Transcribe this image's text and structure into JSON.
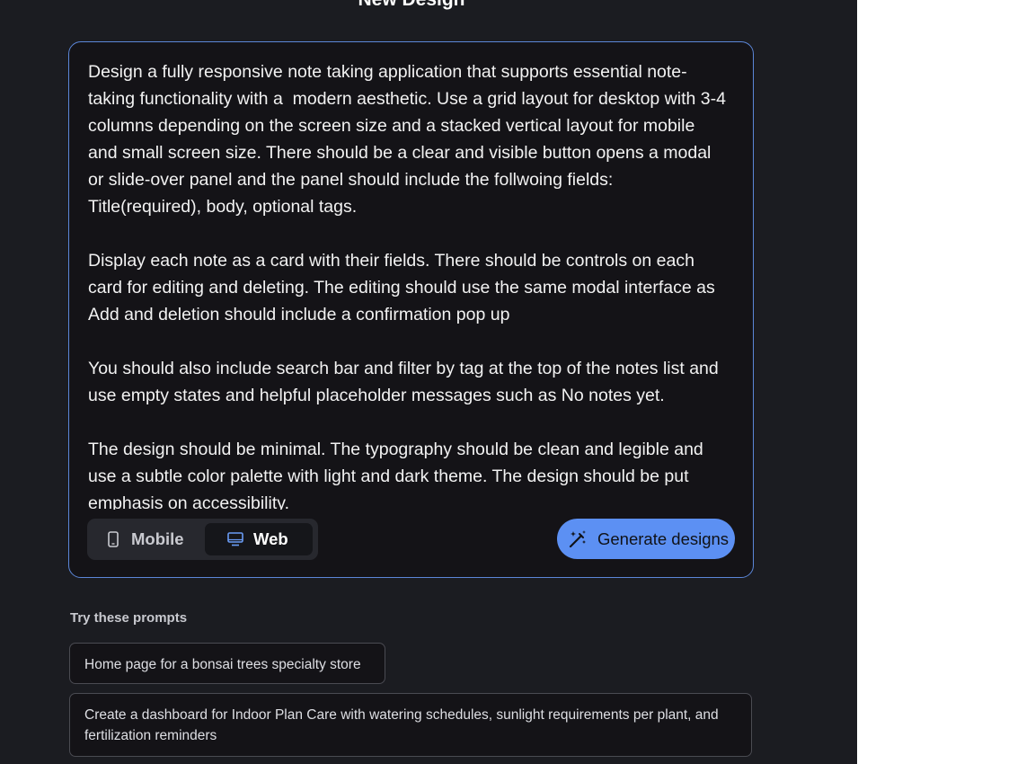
{
  "header": {
    "title": "New Design"
  },
  "prompt": {
    "text": "Design a fully responsive note taking application that supports essential note-taking functionality with a  modern aesthetic. Use a grid layout for desktop with 3-4 columns depending on the screen size and a stacked vertical layout for mobile and small screen size. There should be a clear and visible button opens a modal or slide-over panel and the panel should include the follwoing fields: Title(required), body, optional tags.\n\nDisplay each note as a card with their fields. There should be controls on each card for editing and deleting. The editing should use the same modal interface as Add and deletion should include a confirmation pop up\n\nYou should also include search bar and filter by tag at the top of the notes list and use empty states and helpful placeholder messages such as No notes yet.\n\nThe design should be minimal. The typography should be clean and legible and use a subtle color palette with light and dark theme. The design should be put emphasis on accessibility."
  },
  "device_toggle": {
    "options": [
      {
        "label": "Mobile",
        "icon": "phone-icon",
        "selected": false
      },
      {
        "label": "Web",
        "icon": "monitor-icon",
        "selected": true
      }
    ]
  },
  "generate": {
    "label": "Generate designs",
    "icon": "magic-wand-icon"
  },
  "suggestions": {
    "heading": "Try these prompts",
    "items": [
      "Home page for a bonsai trees specialty store",
      "Create a dashboard for Indoor Plan Care with watering schedules, sunlight requirements per plant, and fertilization reminders"
    ]
  },
  "colors": {
    "panel_bg": "#1b1c21",
    "box_bg": "#141317",
    "accent_border": "#5b86d8",
    "primary_button": "#5c90f3",
    "selected_icon": "#6a9cf5"
  }
}
